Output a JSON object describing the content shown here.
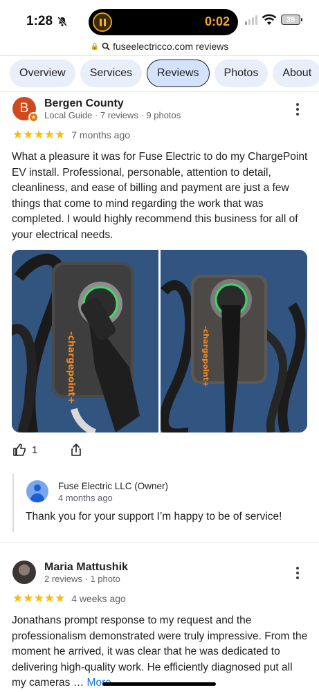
{
  "status_bar": {
    "time": "1:28",
    "recording_time": "0:02",
    "battery": "39"
  },
  "url_bar": {
    "text": "fuseelectricco.com reviews"
  },
  "tabs": [
    {
      "label": "Overview",
      "active": false
    },
    {
      "label": "Services",
      "active": false
    },
    {
      "label": "Reviews",
      "active": true
    },
    {
      "label": "Photos",
      "active": false
    },
    {
      "label": "About",
      "active": false
    }
  ],
  "reviews": [
    {
      "avatar_initial": "B",
      "avatar_color": "#d04a1e",
      "name": "Bergen County",
      "meta": "Local Guide · 7 reviews · 9 photos",
      "rating": 5,
      "stars": "★★★★★",
      "time_ago": "7 months ago",
      "text": "What a pleasure it was for Fuse Electric to do my ChargePoint EV install. Professional, personable, attention to detail, cleanliness, and ease of billing and payment are just a few things that come to mind regarding the work that was completed. I would highly recommend this business for all of your electrical needs.",
      "photo_brand_text": "-chargepoint+",
      "like_count": "1",
      "owner_reply": {
        "name": "Fuse Electric LLC (Owner)",
        "time_ago": "4 months ago",
        "text": "Thank you for your support I’m happy to be of service!"
      }
    },
    {
      "name": "Maria Mattushik",
      "meta": "2 reviews · 1 photo",
      "rating": 5,
      "stars": "★★★★★",
      "time_ago": "4 weeks ago",
      "text": "Jonathans prompt response to my request and the professionalism demonstrated were truly impressive. From the moment he arrived, it was clear that he was dedicated to delivering high-quality work. He efficiently diagnosed put all my cameras …",
      "more_label": "More"
    }
  ],
  "colors": {
    "star": "#fbbc04",
    "link": "#1a73e8",
    "active_tab": "#d3e3fd",
    "tab": "#e8eefa"
  }
}
